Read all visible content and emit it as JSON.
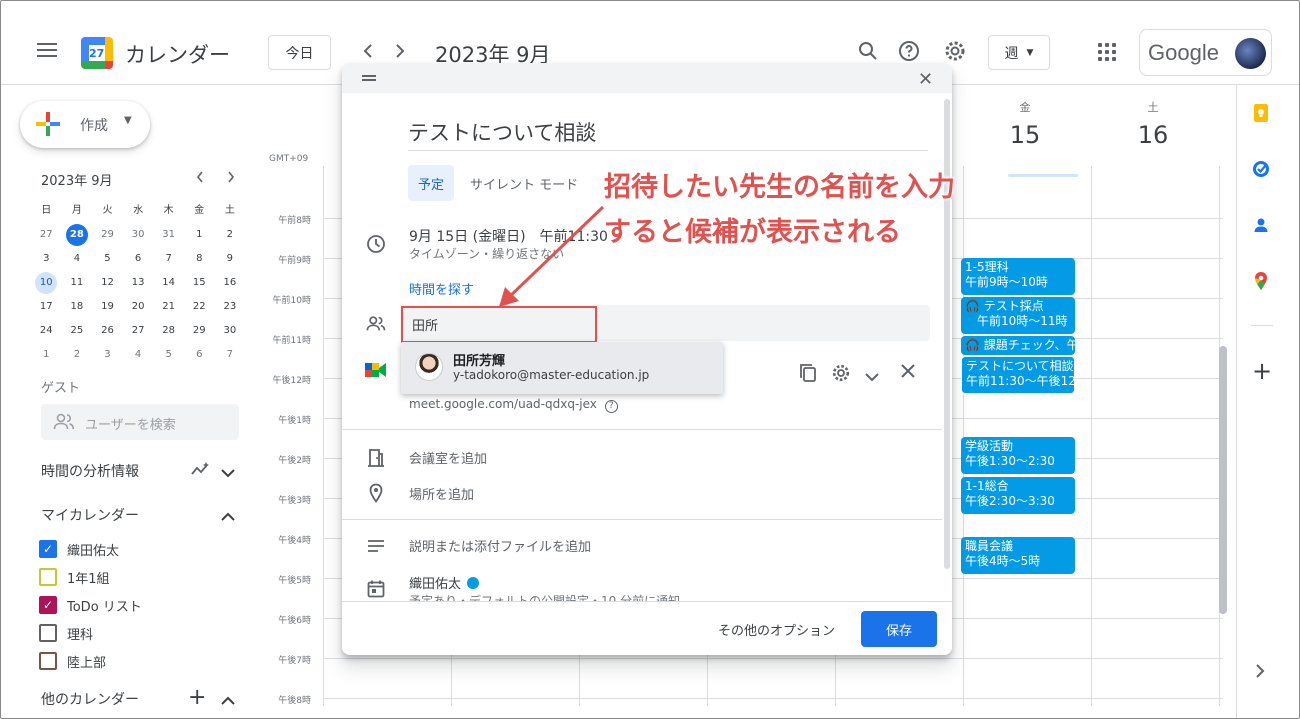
{
  "header": {
    "app_title": "カレンダー",
    "logo_day": "27",
    "today_label": "今日",
    "month_title": "2023年 9月",
    "view_label": "週",
    "google_text": "Google"
  },
  "sidebar": {
    "create_label": "作成",
    "mini_month": "2023年 9月",
    "weekdays": [
      "日",
      "月",
      "火",
      "水",
      "木",
      "金",
      "土"
    ],
    "weeks": [
      [
        "27",
        "28",
        "29",
        "30",
        "31",
        "1",
        "2"
      ],
      [
        "3",
        "4",
        "5",
        "6",
        "7",
        "8",
        "9"
      ],
      [
        "10",
        "11",
        "12",
        "13",
        "14",
        "15",
        "16"
      ],
      [
        "17",
        "18",
        "19",
        "20",
        "21",
        "22",
        "23"
      ],
      [
        "24",
        "25",
        "26",
        "27",
        "28",
        "29",
        "30"
      ],
      [
        "1",
        "2",
        "3",
        "4",
        "5",
        "6",
        "7"
      ]
    ],
    "guest_title": "ゲスト",
    "guest_search_placeholder": "ユーザーを検索",
    "analytics_label": "時間の分析情報",
    "my_calendars_label": "マイカレンダー",
    "my_calendars": [
      {
        "label": "織田佑太",
        "color": "#1a73e8",
        "checked": true
      },
      {
        "label": "1年1組",
        "color": "#c0ca33",
        "checked": false
      },
      {
        "label": "ToDo リスト",
        "color": "#ad1457",
        "checked": true
      },
      {
        "label": "理科",
        "color": "#616161",
        "checked": false
      },
      {
        "label": "陸上部",
        "color": "#795548",
        "checked": false
      }
    ],
    "other_calendars_label": "他のカレンダー"
  },
  "grid": {
    "gmt": "GMT+09",
    "times": [
      "午前8時",
      "午前9時",
      "午前10時",
      "午前11時",
      "午後12時",
      "午後1時",
      "午後2時",
      "午後3時",
      "午後4時",
      "午後5時",
      "午後6時",
      "午後7時",
      "午後8時"
    ],
    "days": [
      {
        "dow": "金",
        "num": "15"
      },
      {
        "dow": "土",
        "num": "16"
      }
    ],
    "events": [
      {
        "line1": "1-5理科",
        "line2": "午前9時～10時"
      },
      {
        "line1": "🎧 テスト採点",
        "line2": "　午前10時～11時"
      },
      {
        "line1": "🎧 課題チェック、午",
        "line2": ""
      },
      {
        "line1": "テストについて相談",
        "line2": "午前11:30～午後12:3"
      },
      {
        "line1": "学級活動",
        "line2": "午後1:30～2:30"
      },
      {
        "line1": "1-1総合",
        "line2": "午後2:30～3:30"
      },
      {
        "line1": "職員会議",
        "line2": "午後4時～5時"
      }
    ]
  },
  "dialog": {
    "title": "テストについて相談",
    "tab_event": "予定",
    "tab_silent": "サイレント モード",
    "date_text": "9月 15日 (金曜日)　午前11:30",
    "timezone_text": "タイムゾーン・繰り返さない",
    "find_time": "時間を探す",
    "guest_input_value": "田所",
    "suggestion": {
      "name": "田所芳輝",
      "email": "y-tadokoro@master-education.jp"
    },
    "meet_link": "meet.google.com/uad-qdxq-jex",
    "add_room": "会議室を追加",
    "add_location": "場所を追加",
    "add_description": "説明または添付ファイルを追加",
    "owner": "織田佑太",
    "owner_sub": "予定あり・デフォルトの公開設定・10 分前に通知",
    "more_options": "その他のオプション",
    "save": "保存"
  },
  "annotation": {
    "line1": "招待したい先生の名前を入力",
    "line2": "すると候補が表示される",
    "color": "#e0524f"
  }
}
